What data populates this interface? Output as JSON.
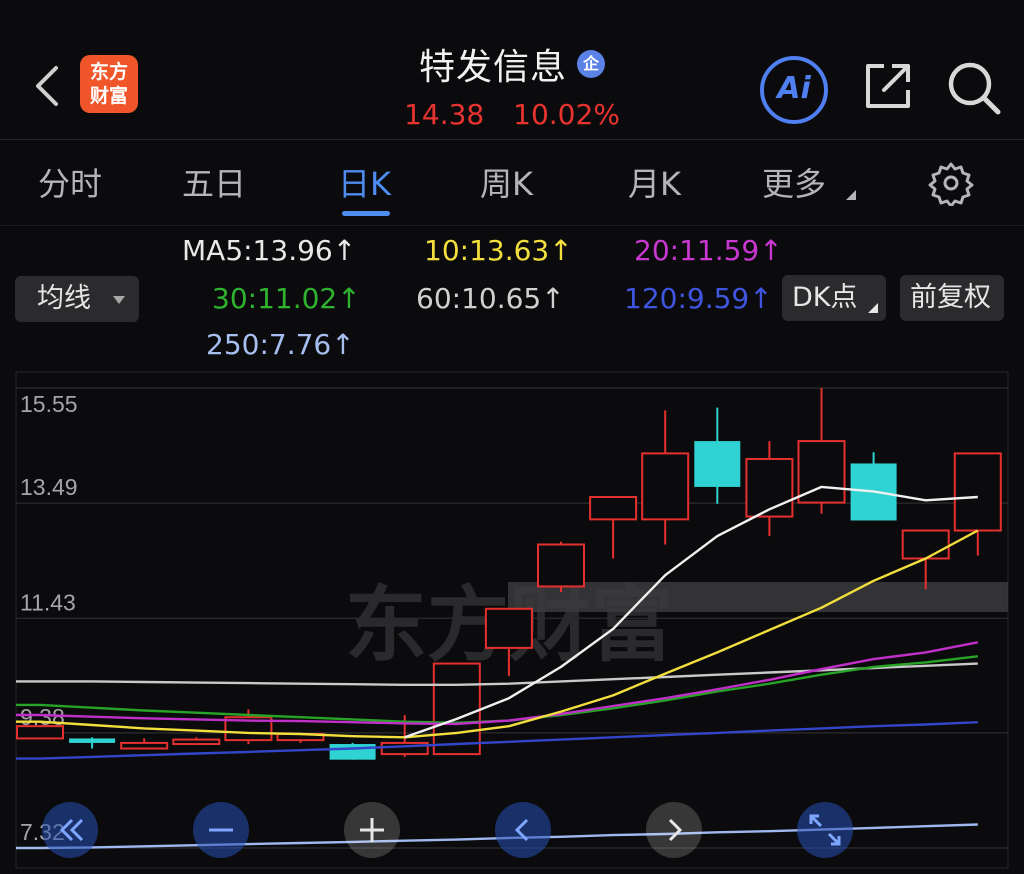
{
  "header": {
    "logo_line1": "东方",
    "logo_line2": "财富",
    "stock_name": "特发信息",
    "badge": "企",
    "price": "14.38",
    "change_pct": "10.02%",
    "ai_label": "Ai"
  },
  "tabs": [
    {
      "label": "分时",
      "active": false
    },
    {
      "label": "五日",
      "active": false
    },
    {
      "label": "日K",
      "active": true
    },
    {
      "label": "周K",
      "active": false
    },
    {
      "label": "月K",
      "active": false
    },
    {
      "label": "更多",
      "active": false
    }
  ],
  "icons": {
    "back": "chevron-left-icon",
    "share": "share-icon",
    "search": "search-icon",
    "settings": "gear-icon"
  },
  "ma_legend": {
    "ma5": "MA5:13.96",
    "ma10": "10:13.63",
    "ma20": "20:11.59",
    "ma30": "30:11.02",
    "ma60": "60:10.65",
    "ma120": "120:9.59",
    "ma250": "250:7.76",
    "arrow": "↑"
  },
  "controls": {
    "indicator_select": "均线",
    "dk_label": "DK点",
    "fuquan_label": "前复权"
  },
  "colors": {
    "up": "#e5302f",
    "down": "#2fd3d3",
    "ma5": "#f0f0f0",
    "ma10": "#f2de3c",
    "ma20": "#c030c8",
    "ma30": "#27a327",
    "ma60": "#c9c9c9",
    "ma120": "#3345c8",
    "ma250": "#9fb8ee",
    "accent": "#4f8cf0"
  },
  "watermark": "东方财富",
  "chart_data": {
    "type": "candlestick",
    "y_ticks": [
      "15.55",
      "13.49",
      "11.43",
      "9.38",
      "7.32"
    ],
    "y_tick_values": [
      15.55,
      13.49,
      11.43,
      9.38,
      7.32
    ],
    "ylim": [
      7.32,
      15.55
    ],
    "candles": [
      {
        "open": 9.28,
        "close": 9.5,
        "high": 9.5,
        "low": 9.28
      },
      {
        "open": 9.28,
        "close": 9.2,
        "high": 9.3,
        "low": 9.1
      },
      {
        "open": 9.1,
        "close": 9.2,
        "high": 9.28,
        "low": 9.1
      },
      {
        "open": 9.18,
        "close": 9.26,
        "high": 9.3,
        "low": 9.18
      },
      {
        "open": 9.25,
        "close": 9.66,
        "high": 9.8,
        "low": 9.18
      },
      {
        "open": 9.25,
        "close": 9.36,
        "high": 9.38,
        "low": 9.2
      },
      {
        "open": 9.18,
        "close": 8.9,
        "high": 9.2,
        "low": 8.9
      },
      {
        "open": 9.0,
        "close": 9.2,
        "high": 9.7,
        "low": 8.95
      },
      {
        "open": 9.0,
        "close": 10.62,
        "high": 10.62,
        "low": 9.0
      },
      {
        "open": 10.9,
        "close": 11.6,
        "high": 11.6,
        "low": 10.4
      },
      {
        "open": 12.0,
        "close": 12.75,
        "high": 12.8,
        "low": 11.9
      },
      {
        "open": 13.2,
        "close": 13.6,
        "high": 13.6,
        "low": 12.5
      },
      {
        "open": 13.2,
        "close": 14.38,
        "high": 15.15,
        "low": 12.75
      },
      {
        "open": 14.6,
        "close": 13.78,
        "high": 15.2,
        "low": 13.48
      },
      {
        "open": 13.25,
        "close": 14.28,
        "high": 14.6,
        "low": 12.9
      },
      {
        "open": 13.5,
        "close": 14.6,
        "high": 15.55,
        "low": 13.3
      },
      {
        "open": 14.2,
        "close": 13.18,
        "high": 14.4,
        "low": 13.18
      },
      {
        "open": 12.5,
        "close": 13.0,
        "high": 13.0,
        "low": 11.95
      },
      {
        "open": 13.0,
        "close": 14.38,
        "high": 14.38,
        "low": 12.55
      }
    ],
    "ma": {
      "ma5": [
        null,
        null,
        null,
        null,
        null,
        null,
        null,
        9.3,
        9.63,
        10.0,
        10.56,
        11.24,
        12.2,
        12.9,
        13.38,
        13.78,
        13.7,
        13.54,
        13.6
      ],
      "ma10": [
        9.58,
        9.52,
        9.46,
        9.42,
        9.38,
        9.36,
        9.32,
        9.3,
        9.38,
        9.5,
        9.76,
        10.05,
        10.44,
        10.82,
        11.22,
        11.62,
        12.1,
        12.5,
        13.0
      ],
      "ma20": [
        9.7,
        9.67,
        9.64,
        9.62,
        9.6,
        9.59,
        9.57,
        9.55,
        9.54,
        9.6,
        9.72,
        9.86,
        10.0,
        10.16,
        10.33,
        10.52,
        10.7,
        10.82,
        11.0
      ],
      "ma30": [
        9.88,
        9.83,
        9.78,
        9.74,
        9.7,
        9.66,
        9.62,
        9.58,
        9.56,
        9.6,
        9.7,
        9.82,
        9.96,
        10.12,
        10.26,
        10.42,
        10.56,
        10.64,
        10.75
      ],
      "ma60": [
        10.3,
        10.3,
        10.29,
        10.28,
        10.27,
        10.26,
        10.25,
        10.24,
        10.24,
        10.26,
        10.3,
        10.34,
        10.38,
        10.42,
        10.46,
        10.5,
        10.54,
        10.58,
        10.62
      ],
      "ma120": [
        8.92,
        8.95,
        8.98,
        9.01,
        9.04,
        9.07,
        9.1,
        9.14,
        9.18,
        9.22,
        9.26,
        9.3,
        9.34,
        9.38,
        9.42,
        9.46,
        9.5,
        9.53,
        9.57
      ],
      "ma250": [
        7.32,
        7.33,
        7.35,
        7.37,
        7.39,
        7.41,
        7.43,
        7.45,
        7.47,
        7.5,
        7.52,
        7.55,
        7.57,
        7.6,
        7.62,
        7.65,
        7.68,
        7.71,
        7.74
      ]
    }
  }
}
